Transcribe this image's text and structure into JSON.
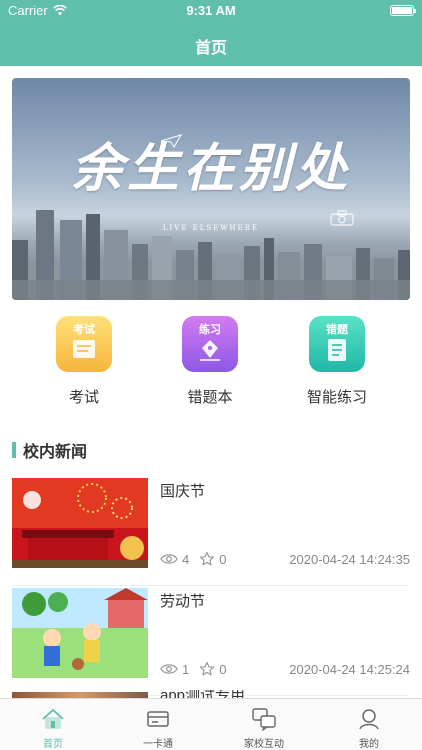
{
  "status_bar": {
    "carrier": "Carrier",
    "time": "9:31 AM"
  },
  "nav": {
    "title": "首页"
  },
  "banner": {
    "calligraphy": "余生在别处",
    "subtitle": "LIVE ELSEWHERE"
  },
  "quick_entries": [
    {
      "tag": "考试",
      "label": "考试",
      "color_from": "#ffe07a",
      "color_to": "#f5b63a",
      "icon": "exam-paper-icon"
    },
    {
      "tag": "练习",
      "label": "错题本",
      "color_from": "#d27bf0",
      "color_to": "#8e57e6",
      "icon": "pen-nib-icon"
    },
    {
      "tag": "错题",
      "label": "智能练习",
      "color_from": "#5be2c6",
      "color_to": "#1fb7a8",
      "icon": "checklist-icon"
    }
  ],
  "section": {
    "title": "校内新闻"
  },
  "news": [
    {
      "title": "国庆节",
      "views": "4",
      "favorites": "0",
      "date": "2020-04-24 14:24:35",
      "thumb": "national-day-thumbnail"
    },
    {
      "title": "劳动节",
      "views": "1",
      "favorites": "0",
      "date": "2020-04-24 14:25:24",
      "thumb": "labor-day-thumbnail"
    },
    {
      "title": "app测试专用"
    }
  ],
  "tabbar": [
    {
      "label": "首页",
      "icon": "home-icon",
      "active": true
    },
    {
      "label": "一卡通",
      "icon": "card-icon",
      "active": false
    },
    {
      "label": "家校互动",
      "icon": "chat-icon",
      "active": false
    },
    {
      "label": "我的",
      "icon": "user-icon",
      "active": false
    }
  ],
  "colors": {
    "accent": "#5fbfaa",
    "text": "#333333",
    "muted": "#888888"
  }
}
